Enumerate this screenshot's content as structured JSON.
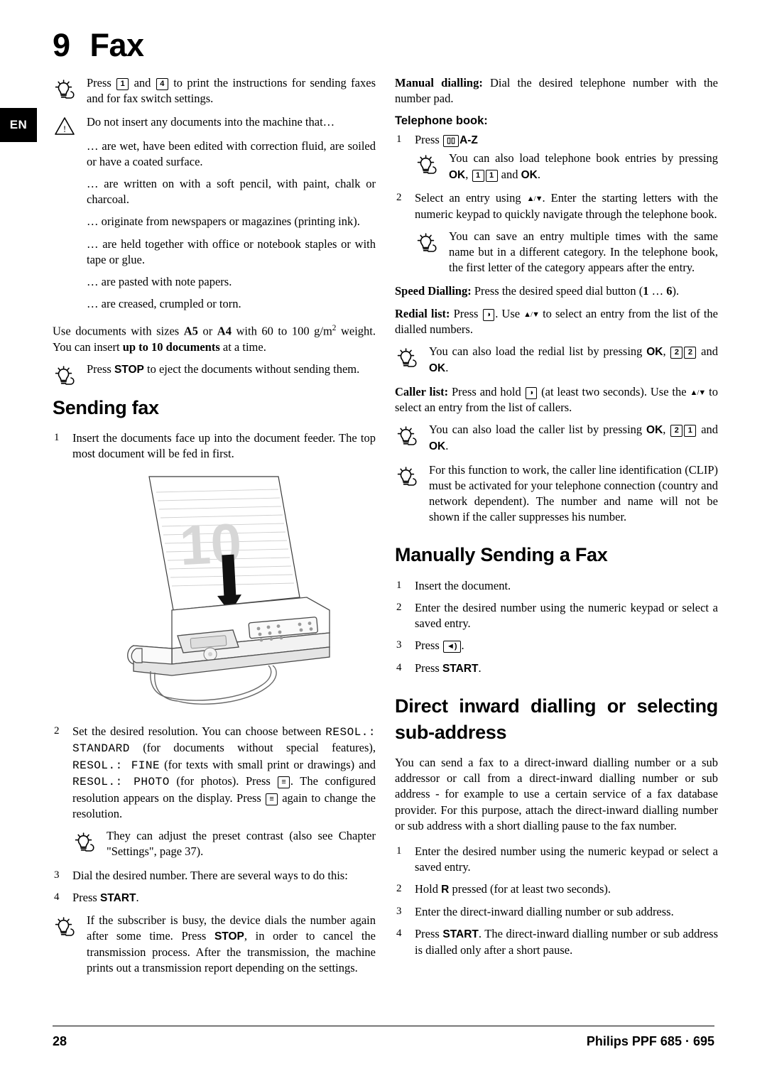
{
  "locale_tab": "EN",
  "chapter": {
    "number": "9",
    "title": "Fax"
  },
  "footer": {
    "page": "28",
    "model": "Philips PPF 685 · 695"
  },
  "left_column": {
    "tip_print_instructions": "Press 1 and 4 to print the instructions for sending faxes and for fax switch settings.",
    "warning_intro": "Do not insert any documents into the machine that…",
    "warning_items": [
      "… are wet, have been edited with correction fluid, are soiled or have a coated surface.",
      "… are written on with a soft pencil, with paint, chalk or charcoal.",
      "… originate from newspapers or magazines (printing ink).",
      "… are held together with office or notebook staples or with tape or glue.",
      "… are pasted with note papers.",
      "… are creased, crumpled or torn."
    ],
    "document_sizes": "Use documents with sizes A5 or A4 with 60 to 100 g/m2 weight. You can insert up to 10 documents at a time.",
    "tip_stop": "Press STOP to eject the documents without sending them.",
    "heading_sending_fax": "Sending fax",
    "step1": "Insert the documents face up into the document feeder. The top most document will be fed in first.",
    "figure_label": "10",
    "step2_pre": "Set the desired resolution. You can choose between ",
    "step2_resol_standard": "RESOL.: STANDARD",
    "step2_mid1": " (for documents without special features), ",
    "step2_resol_fine": "RESOL.: FINE",
    "step2_mid2": " (for texts with small print or drawings) and ",
    "step2_resol_photo": "RESOL.: PHOTO",
    "step2_post": " (for photos). Press . The configured resolution appears on the display. Press  again to change the resolution.",
    "tip_contrast": "They can adjust the preset contrast (also see Chapter \"Settings\", page 37).",
    "step3": "Dial the desired number. There are several ways to do this:",
    "step4": "Press START.",
    "tip_busy": "If the subscriber is busy, the device dials the number again after some time. Press STOP, in order to cancel the transmission process. After the transmission, the machine prints out a transmission report depending on the settings."
  },
  "right_column": {
    "manual_dialling_label": "Manual dialling:",
    "manual_dialling_text": " Dial the desired telephone number with the number pad.",
    "telephone_book_heading": "Telephone book:",
    "tb_step1": "Press  A-Z",
    "tb_tip1": "You can also load telephone book entries by pressing OK, 1 1 and OK.",
    "tb_step2": "Select an entry using /. Enter the starting letters with the numeric keypad to quickly navigate through the telephone book.",
    "tb_tip2": "You can save an entry multiple times with the same name but in a different category. In the telephone book, the first letter of the category appears after the entry.",
    "speed_dialling_label": "Speed Dialling:",
    "speed_dialling_text": " Press the desired speed dial button (1 … 6).",
    "redial_label": "Redial list:",
    "redial_text": " Press . Use / to select an entry from the list of the dialled numbers.",
    "redial_tip": "You can also load the redial list by pressing OK, 2 2 and OK.",
    "caller_label": "Caller list:",
    "caller_text": " Press and hold  (at least two seconds). Use the / to select an entry from the list of callers.",
    "caller_tip": "You can also load the caller list by pressing OK, 2 1 and OK.",
    "clip_tip": "For this function to work, the caller line identification (CLIP) must be activated for your telephone connection (country and network dependent). The number and name will not be shown if the caller suppresses his number.",
    "heading_manually_sending": "Manually Sending a Fax",
    "ms_step1": "Insert the document.",
    "ms_step2": "Enter the desired number using the numeric keypad or select a saved entry.",
    "ms_step3": "Press .",
    "ms_step4": "Press START.",
    "heading_direct_inward": "Direct inward dialling or selecting sub-address",
    "di_intro": "You can send a fax to a direct-inward dialling number or a sub addressor or call from a direct-inward dialling number or sub address - for example to use a certain service of a fax database provider. For this purpose, attach the direct-inward dialling number or sub address with a short dialling pause to the fax number.",
    "di_step1": "Enter the desired number using the numeric keypad or select a saved entry.",
    "di_step2": "Hold R pressed (for at least two seconds).",
    "di_step3": "Enter the direct-inward dialling number or sub address.",
    "di_step4": "Press START. The direct-inward dialling number or sub address is dialled only after a short pause."
  }
}
